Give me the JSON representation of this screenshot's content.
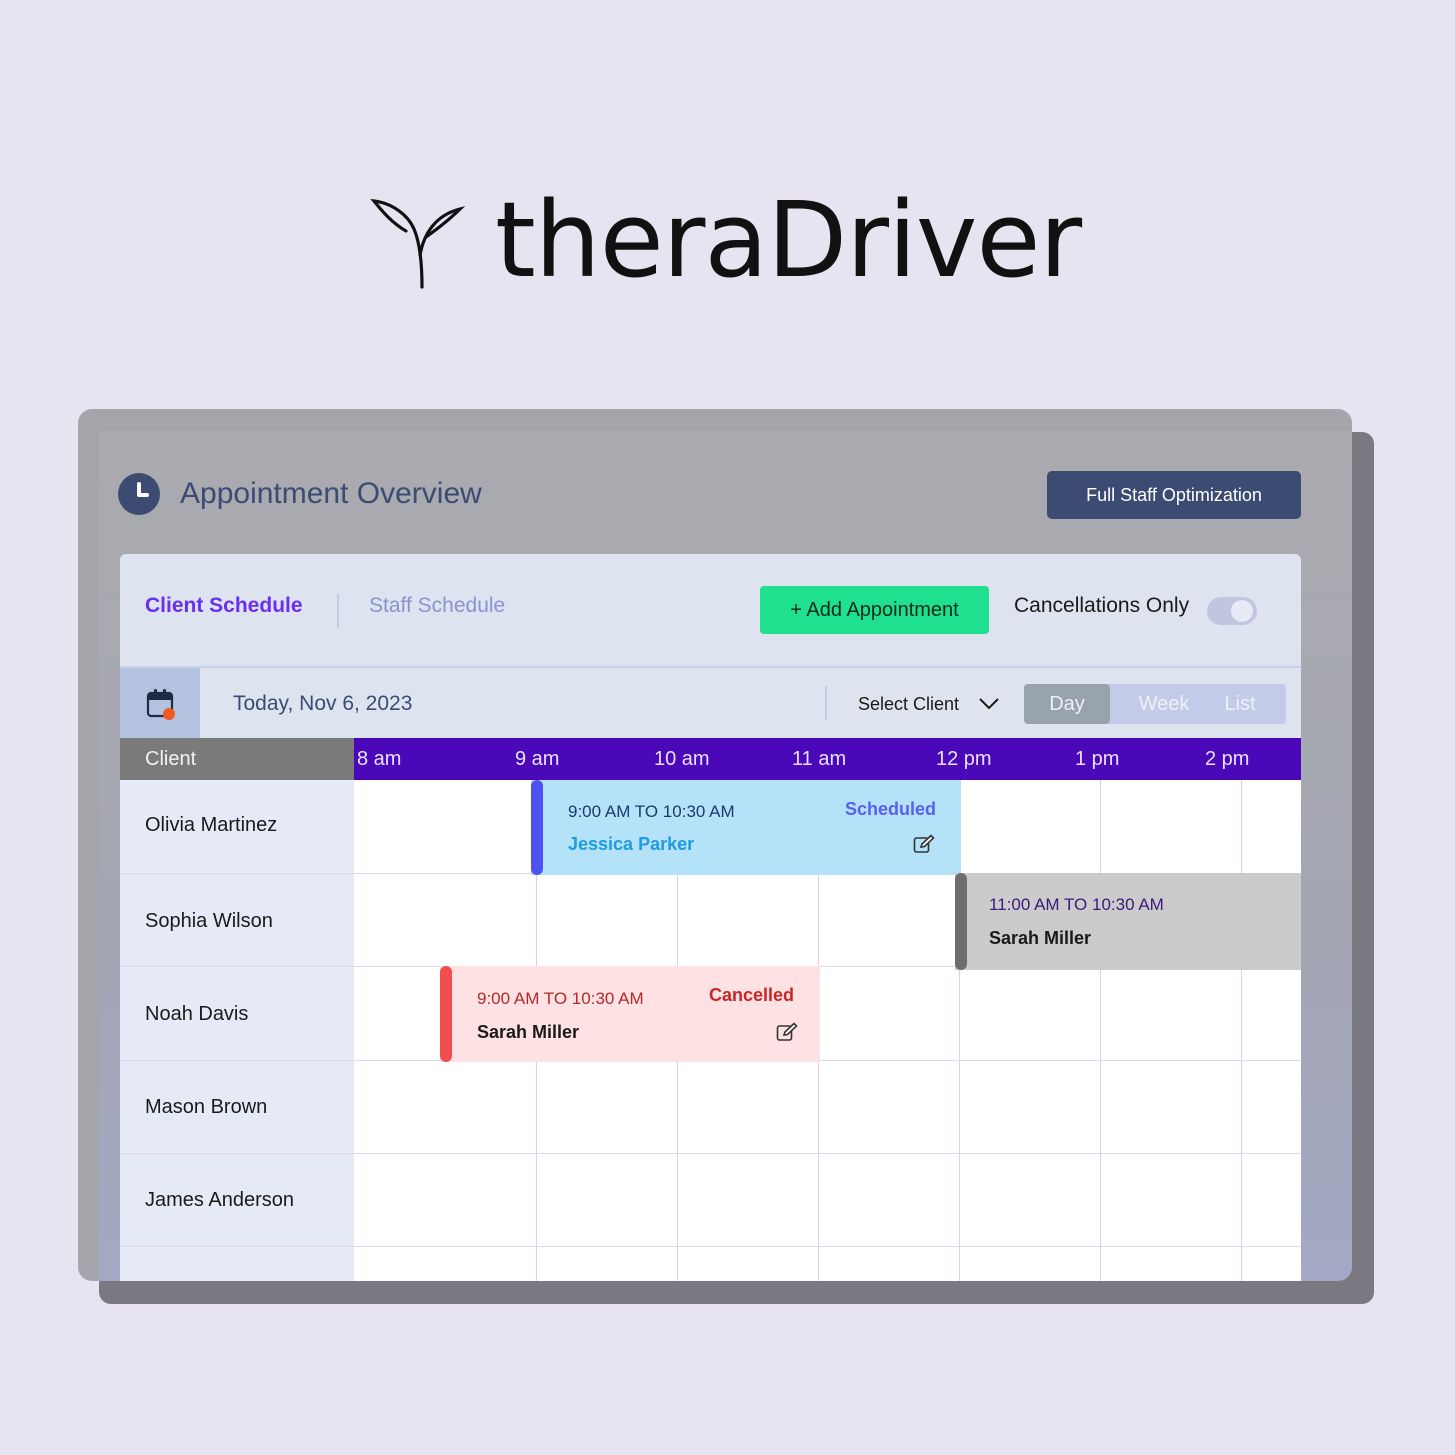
{
  "brand": {
    "name": "theraDriver"
  },
  "header": {
    "title": "Appointment Overview",
    "optimize_label": "Full Staff Optimization"
  },
  "tabs": {
    "client": "Client Schedule",
    "staff": "Staff Schedule",
    "active": "client"
  },
  "actions": {
    "add_label": "+ Add Appointment",
    "cancellations_label": "Cancellations Only",
    "cancellations_on": false
  },
  "toolbar": {
    "date": "Today, Nov 6, 2023",
    "select_client": "Select Client",
    "views": [
      "Day",
      "Week",
      "List"
    ],
    "active_view": "Day"
  },
  "table": {
    "client_header": "Client",
    "hours": [
      "8 am",
      "9 am",
      "10 am",
      "11 am",
      "12 pm",
      "1 pm",
      "2 pm"
    ],
    "clients": [
      "Olivia Martinez",
      "Sophia Wilson",
      "Noah Davis",
      "Mason Brown",
      "James Anderson"
    ]
  },
  "appointments": [
    {
      "client": "Olivia Martinez",
      "time": "9:00 AM TO 10:30 AM",
      "staff": "Jessica Parker",
      "status": "Scheduled"
    },
    {
      "client": "Sophia Wilson",
      "time": "11:00 AM TO 10:30 AM",
      "staff": "Sarah Miller",
      "status": ""
    },
    {
      "client": "Noah Davis",
      "time": "9:00 AM TO 10:30 AM",
      "staff": "Sarah Miller",
      "status": "Cancelled"
    }
  ],
  "colors": {
    "background": "#e8e3f1",
    "primary": "#3b4b72",
    "accent_purple": "#4a08b8",
    "add_green": "#1fe08e",
    "scheduled_bg": "#b4e2f9",
    "cancelled_bg": "#fde1e3",
    "cancelled_bar": "#f04d4f"
  },
  "icons": [
    "sprout-logo-icon",
    "clock-icon",
    "calendar-icon",
    "chevron-down-icon",
    "edit-icon"
  ]
}
